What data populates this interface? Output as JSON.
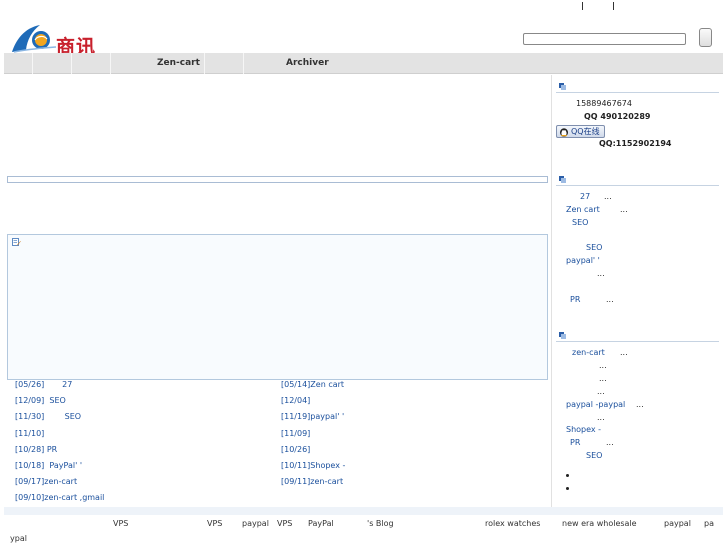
{
  "header": {
    "logo_text": "商讯",
    "colors": {
      "logo_red": "#c8202c",
      "logo_blue": "#1f6bb8",
      "link_blue": "#1a4f9c"
    }
  },
  "nav": {
    "items": [
      "Zen-cart",
      "Archiver"
    ]
  },
  "news": {
    "left": [
      {
        "date": "[05/26]",
        "title": "27"
      },
      {
        "date": "[12/09]",
        "title": "SEO"
      },
      {
        "date": "[11/30]",
        "title": "SEO"
      },
      {
        "date": "[11/10]",
        "title": ""
      },
      {
        "date": "[10/28]",
        "title": "PR"
      },
      {
        "date": "[10/18]",
        "title": "PayPal' '"
      },
      {
        "date": "[09/17]",
        "title": "zen-cart"
      },
      {
        "date": "[09/10]",
        "title": "zen-cart ,gmail"
      }
    ],
    "right": [
      {
        "date": "[05/14]",
        "title": "Zen cart"
      },
      {
        "date": "[12/04]",
        "title": ""
      },
      {
        "date": "[11/19]",
        "title": "paypal' '"
      },
      {
        "date": "[11/09]",
        "title": ""
      },
      {
        "date": "[10/26]",
        "title": ""
      },
      {
        "date": "[10/11]",
        "title": "Shopex -"
      },
      {
        "date": "[09/11]",
        "title": "zen-cart"
      }
    ]
  },
  "sidebar": {
    "contact": {
      "phone": "15889467674",
      "qq_line": "QQ  490120289",
      "qq_badge": "QQ在线",
      "qq2_line": "QQ:1152902194"
    },
    "list1": [
      {
        "text": "27",
        "dots": "..."
      },
      {
        "text": "Zen cart",
        "dots": "..."
      },
      {
        "text": "SEO",
        "dots": ""
      },
      {
        "text": "SEO",
        "dots": ""
      },
      {
        "text": "paypal' '",
        "dots": ""
      },
      {
        "text": "",
        "dots": "..."
      },
      {
        "text": "PR",
        "dots": "..."
      }
    ],
    "list2": [
      {
        "text": "zen-cart",
        "dots": "..."
      },
      {
        "text": "",
        "dots": "..."
      },
      {
        "text": "",
        "dots": "..."
      },
      {
        "text": "",
        "dots": "..."
      },
      {
        "text": "paypal -paypal",
        "dots": "..."
      },
      {
        "text": "",
        "dots": "..."
      },
      {
        "text": "Shopex -",
        "dots": ""
      },
      {
        "text": "PR",
        "dots": "..."
      },
      {
        "text": "SEO",
        "dots": ""
      }
    ]
  },
  "footer": {
    "links": [
      "VPS",
      "VPS",
      "paypal",
      "VPS",
      "PayPal",
      "'s Blog",
      "rolex watches",
      "new era wholesale",
      "paypal",
      "pa",
      "ypal"
    ]
  }
}
